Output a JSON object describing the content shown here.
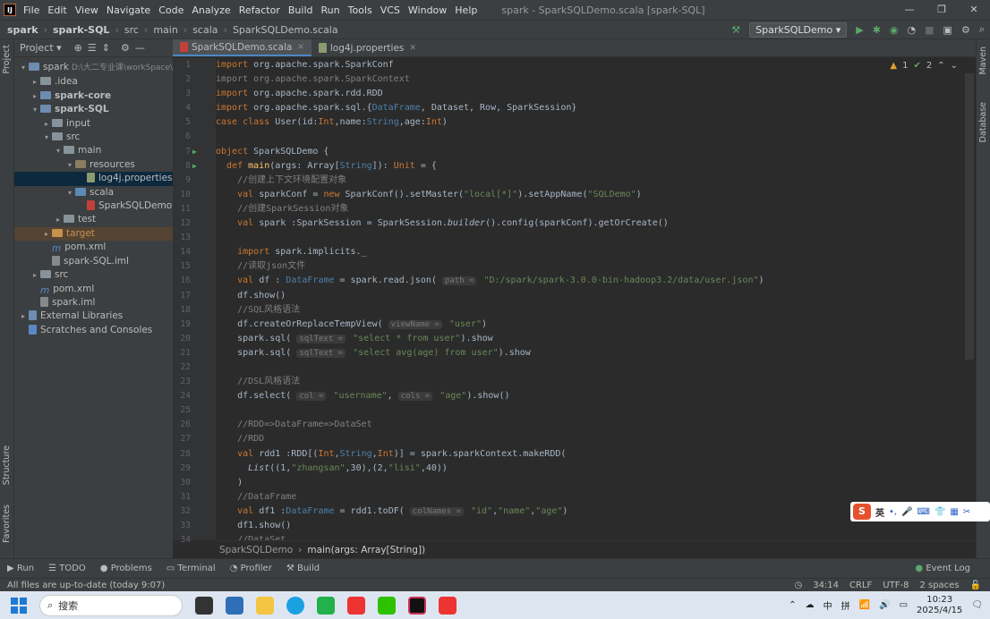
{
  "titlebar": {
    "menus": [
      "File",
      "Edit",
      "View",
      "Navigate",
      "Code",
      "Analyze",
      "Refactor",
      "Build",
      "Run",
      "Tools",
      "VCS",
      "Window",
      "Help"
    ],
    "title": "spark - SparkSQLDemo.scala [spark-SQL]"
  },
  "nav": {
    "crumbs": [
      "spark",
      "spark-SQL",
      "src",
      "main",
      "scala",
      "SparkSQLDemo.scala"
    ],
    "run_config": "SparkSQLDemo"
  },
  "project": {
    "label": "Project",
    "tree": [
      {
        "d": 0,
        "a": "▾",
        "i": "mod",
        "t": "spark",
        "x": "D:\\大二专业课\\workSpace\\"
      },
      {
        "d": 1,
        "a": "▸",
        "i": "dir",
        "t": ".idea"
      },
      {
        "d": 1,
        "a": "▸",
        "i": "mod",
        "t": "spark-core",
        "b": true
      },
      {
        "d": 1,
        "a": "▾",
        "i": "mod",
        "t": "spark-SQL",
        "b": true
      },
      {
        "d": 2,
        "a": "▸",
        "i": "dir",
        "t": "input"
      },
      {
        "d": 2,
        "a": "▾",
        "i": "dir",
        "t": "src"
      },
      {
        "d": 3,
        "a": "▾",
        "i": "dir",
        "t": "main"
      },
      {
        "d": 4,
        "a": "▾",
        "i": "res",
        "t": "resources"
      },
      {
        "d": 5,
        "a": "",
        "i": "prop",
        "t": "log4j.properties",
        "sel": true
      },
      {
        "d": 4,
        "a": "▾",
        "i": "src",
        "t": "scala"
      },
      {
        "d": 5,
        "a": "",
        "i": "scala",
        "t": "SparkSQLDemo"
      },
      {
        "d": 3,
        "a": "▸",
        "i": "dir",
        "t": "test"
      },
      {
        "d": 2,
        "a": "▸",
        "i": "tg",
        "t": "target",
        "tgt": true
      },
      {
        "d": 2,
        "a": "",
        "i": "m",
        "t": "pom.xml"
      },
      {
        "d": 2,
        "a": "",
        "i": "iml",
        "t": "spark-SQL.iml"
      },
      {
        "d": 1,
        "a": "▸",
        "i": "dir",
        "t": "src"
      },
      {
        "d": 1,
        "a": "",
        "i": "m",
        "t": "pom.xml"
      },
      {
        "d": 1,
        "a": "",
        "i": "iml",
        "t": "spark.iml"
      },
      {
        "d": 0,
        "a": "▸",
        "i": "lib",
        "t": "External Libraries"
      },
      {
        "d": 0,
        "a": "",
        "i": "scr",
        "t": "Scratches and Consoles"
      }
    ]
  },
  "side": {
    "left_top": "Project",
    "left_mid": "Structure",
    "left_bot": "Favorites",
    "right_top": "Maven",
    "right_mid": "Database"
  },
  "tabs": [
    {
      "label": "SparkSQLDemo.scala",
      "active": true
    },
    {
      "label": "log4j.properties",
      "active": false
    }
  ],
  "editor_status": {
    "warnings": "1",
    "ok": "2"
  },
  "code": [
    [
      [
        "kw",
        "import "
      ],
      [
        "",
        "org.apache.spark.SparkConf"
      ]
    ],
    [
      [
        "cm",
        "import org.apache.spark.SparkContext"
      ]
    ],
    [
      [
        "kw",
        "import "
      ],
      [
        "",
        "org.apache.spark.rdd.RDD"
      ]
    ],
    [
      [
        "kw",
        "import "
      ],
      [
        "",
        "org.apache.spark.sql.{"
      ],
      [
        "ty",
        "DataFrame"
      ],
      [
        "",
        ", Dataset, Row, SparkSession}"
      ]
    ],
    [
      [
        "kw",
        "case class "
      ],
      [
        "",
        "User(id:"
      ],
      [
        "kw",
        "Int"
      ],
      [
        "",
        ",name:"
      ],
      [
        "ty",
        "String"
      ],
      [
        "",
        ",age:"
      ],
      [
        "kw",
        "Int"
      ],
      [
        "",
        ")"
      ]
    ],
    [],
    [
      [
        "kw",
        "object "
      ],
      [
        "",
        "SparkSQLDemo {"
      ]
    ],
    [
      [
        "",
        "  "
      ],
      [
        "kw",
        "def "
      ],
      [
        "fn",
        "main"
      ],
      [
        "",
        "(args: Array["
      ],
      [
        "ty",
        "String"
      ],
      [
        "",
        "]): "
      ],
      [
        "kw",
        "Unit"
      ],
      [
        "",
        " = {"
      ]
    ],
    [
      [
        "cm",
        "    //创建上下文环境配置对象"
      ]
    ],
    [
      [
        "",
        "    "
      ],
      [
        "kw",
        "val "
      ],
      [
        "",
        "sparkConf = "
      ],
      [
        "kw",
        "new "
      ],
      [
        "",
        "SparkConf().setMaster("
      ],
      [
        "str",
        "\"local[*]\""
      ],
      [
        "",
        ").setAppName("
      ],
      [
        "str",
        "\"SQLDemo\""
      ],
      [
        "",
        ")"
      ]
    ],
    [
      [
        "cm",
        "    //创建SparkSession对象"
      ]
    ],
    [
      [
        "",
        "    "
      ],
      [
        "kw",
        "val "
      ],
      [
        "",
        "spark :SparkSession = SparkSession."
      ],
      [
        "it",
        "builder"
      ],
      [
        "",
        "().config(sparkConf).getOrCreate()"
      ]
    ],
    [],
    [
      [
        "",
        "    "
      ],
      [
        "kw",
        "import "
      ],
      [
        "",
        "spark.implicits._"
      ]
    ],
    [
      [
        "cm",
        "    //读取json文件"
      ]
    ],
    [
      [
        "",
        "    "
      ],
      [
        "kw",
        "val "
      ],
      [
        "",
        "df : "
      ],
      [
        "ty",
        "DataFrame"
      ],
      [
        "",
        " = spark.read.json( "
      ],
      [
        "hint",
        "path ="
      ],
      [
        "str",
        " \"D:/spark/spark-3.0.0-bin-hadoop3.2/data/user.json\""
      ],
      [
        "",
        ")"
      ]
    ],
    [
      [
        "",
        "    df.show()"
      ]
    ],
    [
      [
        "cm",
        "    //SQL风格语法"
      ]
    ],
    [
      [
        "",
        "    df.createOrReplaceTempView( "
      ],
      [
        "hint",
        "viewName ="
      ],
      [
        "str",
        " \"user\""
      ],
      [
        "",
        ")"
      ]
    ],
    [
      [
        "",
        "    spark.sql( "
      ],
      [
        "hint",
        "sqlText ="
      ],
      [
        "str",
        " \"select * from user\""
      ],
      [
        "",
        ").show"
      ]
    ],
    [
      [
        "",
        "    spark.sql( "
      ],
      [
        "hint",
        "sqlText ="
      ],
      [
        "str",
        " \"select avg(age) from user\""
      ],
      [
        "",
        ").show"
      ]
    ],
    [],
    [
      [
        "cm",
        "    //DSL风格语法"
      ]
    ],
    [
      [
        "",
        "    df.select( "
      ],
      [
        "hint",
        "col ="
      ],
      [
        "str",
        " \"username\""
      ],
      [
        "",
        ", "
      ],
      [
        "hint",
        "cols ="
      ],
      [
        "str",
        " \"age\""
      ],
      [
        "",
        ").show()"
      ]
    ],
    [],
    [
      [
        "cm",
        "    //RDD=>DataFrame=>DataSet"
      ]
    ],
    [
      [
        "cm",
        "    //RDD"
      ]
    ],
    [
      [
        "",
        "    "
      ],
      [
        "kw",
        "val "
      ],
      [
        "",
        "rdd1 :RDD[("
      ],
      [
        "kw",
        "Int"
      ],
      [
        "",
        ","
      ],
      [
        "ty",
        "String"
      ],
      [
        "",
        ","
      ],
      [
        "kw",
        "Int"
      ],
      [
        "",
        ")] = spark.sparkContext.makeRDD("
      ]
    ],
    [
      [
        "",
        "      "
      ],
      [
        "it",
        "List"
      ],
      [
        "",
        "((1,"
      ],
      [
        "str",
        "\"zhangsan\""
      ],
      [
        "",
        ",30),(2,"
      ],
      [
        "str",
        "\"lisi\""
      ],
      [
        "",
        ",40))"
      ]
    ],
    [
      [
        "",
        "    )"
      ]
    ],
    [
      [
        "cm",
        "    //DataFrame"
      ]
    ],
    [
      [
        "",
        "    "
      ],
      [
        "kw",
        "val "
      ],
      [
        "",
        "df1 :"
      ],
      [
        "ty",
        "DataFrame"
      ],
      [
        "",
        " = rdd1.toDF( "
      ],
      [
        "hint",
        "colNames ="
      ],
      [
        "str",
        " \"id\""
      ],
      [
        "",
        ","
      ],
      [
        "str",
        "\"name\""
      ],
      [
        "",
        ","
      ],
      [
        "str",
        "\"age\""
      ],
      [
        "",
        ")"
      ]
    ],
    [
      [
        "",
        "    df1.show()"
      ]
    ],
    [
      [
        "cm",
        "    //DataSet"
      ]
    ]
  ],
  "crumbbar": {
    "a": "SparkSQLDemo",
    "b": "main(args: Array[String])"
  },
  "toolwindows": [
    "Run",
    "TODO",
    "Problems",
    "Terminal",
    "Profiler",
    "Build"
  ],
  "event_log": "Event Log",
  "status": {
    "msg": "All files are up-to-date (today 9:07)",
    "pos": "34:14",
    "eol": "CRLF",
    "enc": "UTF-8",
    "indent": "2 spaces"
  },
  "ime": {
    "lang": "英"
  },
  "taskbar": {
    "search": "搜索",
    "time": "10:23",
    "date": "2025/4/15"
  }
}
